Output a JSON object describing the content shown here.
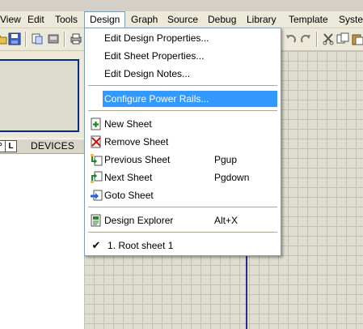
{
  "menubar": {
    "items": [
      "View",
      "Edit",
      "Tools",
      "Design",
      "Graph",
      "Source",
      "Debug",
      "Library",
      "Template",
      "System"
    ]
  },
  "toolbar": {
    "icons": [
      "open-icon",
      "save-icon",
      "import-icon",
      "export-icon",
      "print-icon",
      "redo-icon",
      "cut-icon",
      "copy-icon",
      "paste-icon"
    ]
  },
  "devices_panel": {
    "p_button": "P",
    "l_button": "L",
    "title": "DEVICES"
  },
  "design_menu": {
    "items": [
      {
        "label": "Edit Design Properties...",
        "shortcut": ""
      },
      {
        "label": "Edit Sheet Properties...",
        "shortcut": ""
      },
      {
        "label": "Edit Design Notes...",
        "shortcut": ""
      },
      {
        "label": "Configure Power Rails...",
        "shortcut": ""
      },
      {
        "label": "New Sheet",
        "shortcut": ""
      },
      {
        "label": "Remove Sheet",
        "shortcut": ""
      },
      {
        "label": "Previous Sheet",
        "shortcut": "Pgup"
      },
      {
        "label": "Next Sheet",
        "shortcut": "Pgdown"
      },
      {
        "label": "Goto Sheet",
        "shortcut": ""
      },
      {
        "label": "Design Explorer",
        "shortcut": "Alt+X"
      },
      {
        "label": "1. Root sheet 1",
        "shortcut": ""
      }
    ],
    "highlighted_item": "Configure Power Rails...",
    "checked_item": "1. Root sheet 1"
  },
  "colors": {
    "menu_highlight": "#3399ff",
    "sheet_border": "#23318c",
    "canvas_grid": "#c2c2b0"
  }
}
